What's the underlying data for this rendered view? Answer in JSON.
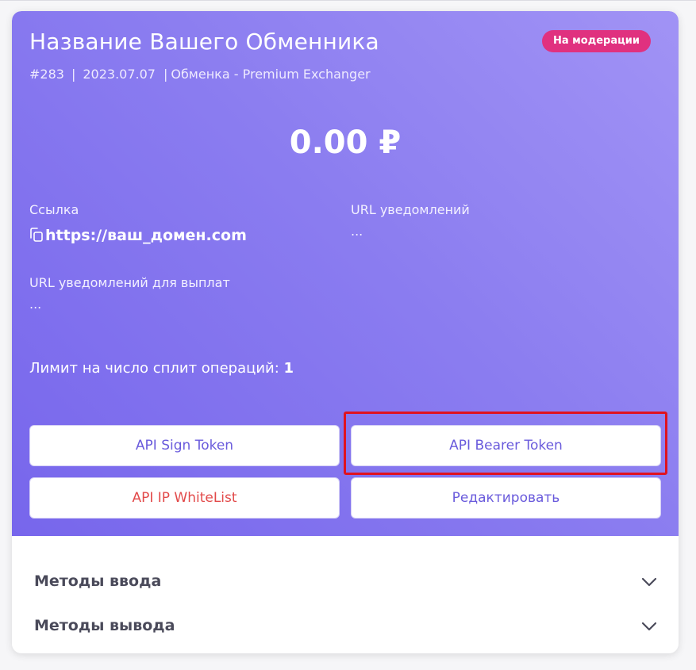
{
  "exchanger": {
    "title": "Название Вашего Обменника",
    "status_badge": "На модерации",
    "id": "#283",
    "date": "2023.07.07",
    "type": "Обменка - Premium Exchanger",
    "balance": "0.00 ₽"
  },
  "fields": {
    "link_label": "Ссылка",
    "link_value": "https://ваш_домен.com",
    "notify_url_label": "URL уведомлений",
    "notify_url_value": "...",
    "payout_url_label": "URL уведомлений для выплат",
    "payout_url_value": "..."
  },
  "limit": {
    "label": "Лимит на число сплит операций:",
    "value": "1"
  },
  "buttons": {
    "api_sign_token": "API Sign Token",
    "api_bearer_token": "API Bearer Token",
    "api_ip_whitelist": "API IP WhiteList",
    "edit": "Редактировать"
  },
  "sections": [
    {
      "label": "Методы ввода"
    },
    {
      "label": "Методы вывода"
    }
  ],
  "icons": {
    "copy": "copy-icon",
    "chevron": "chevron-down-icon"
  },
  "colors": {
    "badge": "#e0317f",
    "accent": "#6a5bdc",
    "danger": "#e24a4a",
    "highlight": "#e0121f"
  }
}
